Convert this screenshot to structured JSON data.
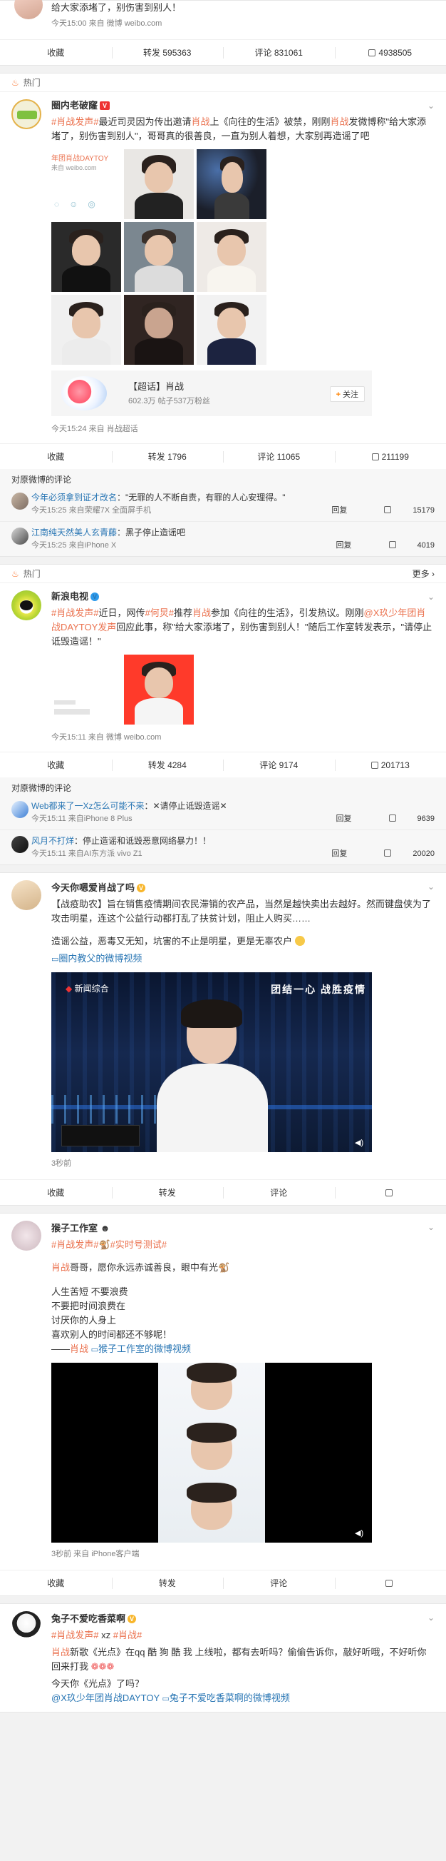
{
  "top_card": {
    "text": "给大家添堵了，别伤害到别人！",
    "meta": "今天15:00  来自 微博 weibo.com",
    "actions": {
      "fav": "收藏",
      "repost": "转发 595363",
      "comment": "评论 831061",
      "like": "4938505"
    }
  },
  "post1": {
    "hot_label": "热门",
    "user": "圈内老破窿",
    "text_parts": [
      "#肖战发声#",
      "最近司灵因为传出邀请",
      "肖战",
      "上《向往的生活》被禁，刚刚",
      "肖战",
      "发微博称\"给大家添堵了，别伤害到别人\"，哥哥真的很善良，一直为别人着想，大家别再造谣了吧"
    ],
    "image_caption": "年团肖战DAYTOY",
    "image_caption2": "来自 weibo.com",
    "super_topic": {
      "title": "【超话】肖战",
      "sub": "602.3万 帖子537万粉丝",
      "follow": "关注"
    },
    "meta": "今天15:24  来自 肖战超话",
    "actions": {
      "fav": "收藏",
      "repost": "转发 1796",
      "comment": "评论 11065",
      "like": "211199"
    },
    "comments_head": "对原微博的评论",
    "comments": [
      {
        "user": "今年必须拿到证才改名",
        "text": "：\"无罪的人不断自责，有罪的人心安理得。\"",
        "meta": "今天15:25  来自荣耀7X 全面屏手机",
        "reply": "回复",
        "like": "15179"
      },
      {
        "user": "江南纯天然美人玄青藤",
        "text": "：黑子停止造谣吧",
        "meta": "今天15:25  来自iPhone X",
        "reply": "回复",
        "like": "4019"
      }
    ]
  },
  "post2": {
    "hot_label": "热门",
    "more": "更多",
    "user": "新浪电视",
    "text_parts": [
      "#肖战发声#",
      "近日，网传",
      "#何炅#",
      "推荐",
      "肖战",
      "参加《向往的生活》，引发热议。刚刚",
      "@X玖少年团肖战DAYTOY",
      "发声",
      "回应此事，称\"给大家添堵了，别伤害到别人！\"随后工作室转发表示，\"请停止诋毁造谣！\""
    ],
    "meta": "今天15:11  来自 微博 weibo.com",
    "actions": {
      "fav": "收藏",
      "repost": "转发 4284",
      "comment": "评论 9174",
      "like": "201713"
    },
    "comments_head": "对原微博的评论",
    "comments": [
      {
        "user": "Web都来了一Xz怎么可能不来",
        "text": "：✕请停止诋毁造谣✕",
        "meta": "今天15:11  来自iPhone 8 Plus",
        "reply": "回复",
        "like": "9639"
      },
      {
        "user": "风月不打烊",
        "text": "：停止造谣和诋毁恶意网络暴力！！",
        "meta": "今天15:11  来自AI东方派 vivo Z1",
        "reply": "回复",
        "like": "20020"
      }
    ]
  },
  "post3": {
    "user": "今天你嗯爱肖战了吗",
    "text1": "【战疫助农】旨在销售疫情期间农民滞销的农产品，当然是越快卖出去越好。然而键盘侠为了攻击明星，连这个公益行动都打乱了扶贫计划，阻止人购买……",
    "text2": "造谣公益，恶毒又无知，坑害的不止是明星，更是无辜农户",
    "video_link": "圈内教父的微博视频",
    "video_logo": "新闻综合",
    "video_banner": "团结一心 战胜疫情",
    "meta": "3秒前",
    "actions": {
      "fav": "收藏",
      "repost": "转发",
      "comment": "评论",
      "like": ""
    }
  },
  "post4": {
    "user": "猴子工作室",
    "tags": [
      "#肖战发声#",
      "#实时号测试#"
    ],
    "line1_link": "肖战",
    "line1": "哥哥，愿你永远赤诚善良，眼中有光",
    "lines": [
      "人生苦短 不要浪费",
      "不要把时间浪费在",
      "讨厌你的人身上",
      "喜欢别人的时间都还不够呢！"
    ],
    "sig_prefix": "——",
    "sig_link": "肖战",
    "video_link": "猴子工作室的微博视频",
    "meta": "3秒前  来自 iPhone客户端",
    "actions": {
      "fav": "收藏",
      "repost": "转发",
      "comment": "评论",
      "like": ""
    }
  },
  "post5": {
    "user": "兔子不爱吃香菜啊",
    "tags": [
      "#肖战发声#",
      "xz",
      "#肖战#"
    ],
    "text": "新歌《光点》在qq 酷 狗 酷 我 上线啦，都有去听吗？偷偷告诉你，敲好听哦，不好听你回来打我",
    "text2": "今天你《光点》了吗？",
    "mention": "@X玖少年团肖战DAYTOY",
    "video_link": "兔子不爱吃香菜啊的微博视频"
  }
}
